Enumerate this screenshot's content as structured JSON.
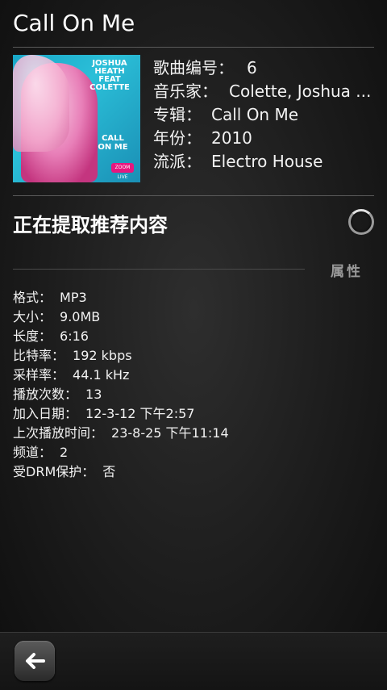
{
  "header": {
    "title": "Call On Me"
  },
  "cover": {
    "artist_text": "JOSHUA HEATH FEAT COLETTE",
    "title_text": "CALL ON ME",
    "label_text": "ZOOM LIVE"
  },
  "details": [
    {
      "key": "歌曲编号：",
      "value": "6"
    },
    {
      "key": "音乐家：",
      "value": "Colette, Joshua ..."
    },
    {
      "key": "专辑：",
      "value": "Call On Me"
    },
    {
      "key": "年份：",
      "value": "2010"
    },
    {
      "key": "流派：",
      "value": "Electro House"
    }
  ],
  "recommendations": {
    "status": "正在提取推荐内容"
  },
  "properties": {
    "header": "属性",
    "items": [
      {
        "key": "格式：",
        "value": "MP3"
      },
      {
        "key": "大小：",
        "value": "9.0MB"
      },
      {
        "key": "长度：",
        "value": "6:16"
      },
      {
        "key": "比特率：",
        "value": "192 kbps"
      },
      {
        "key": "采样率：",
        "value": "44.1 kHz"
      },
      {
        "key": "播放次数：",
        "value": "13"
      },
      {
        "key": "加入日期：",
        "value": "12-3-12 下午2:57"
      },
      {
        "key": "上次播放时间：",
        "value": "23-8-25 下午11:14"
      },
      {
        "key": "频道：",
        "value": "2"
      },
      {
        "key": "受DRM保护：",
        "value": "否"
      }
    ]
  },
  "toolbar": {
    "back_icon": "back-arrow-icon"
  }
}
